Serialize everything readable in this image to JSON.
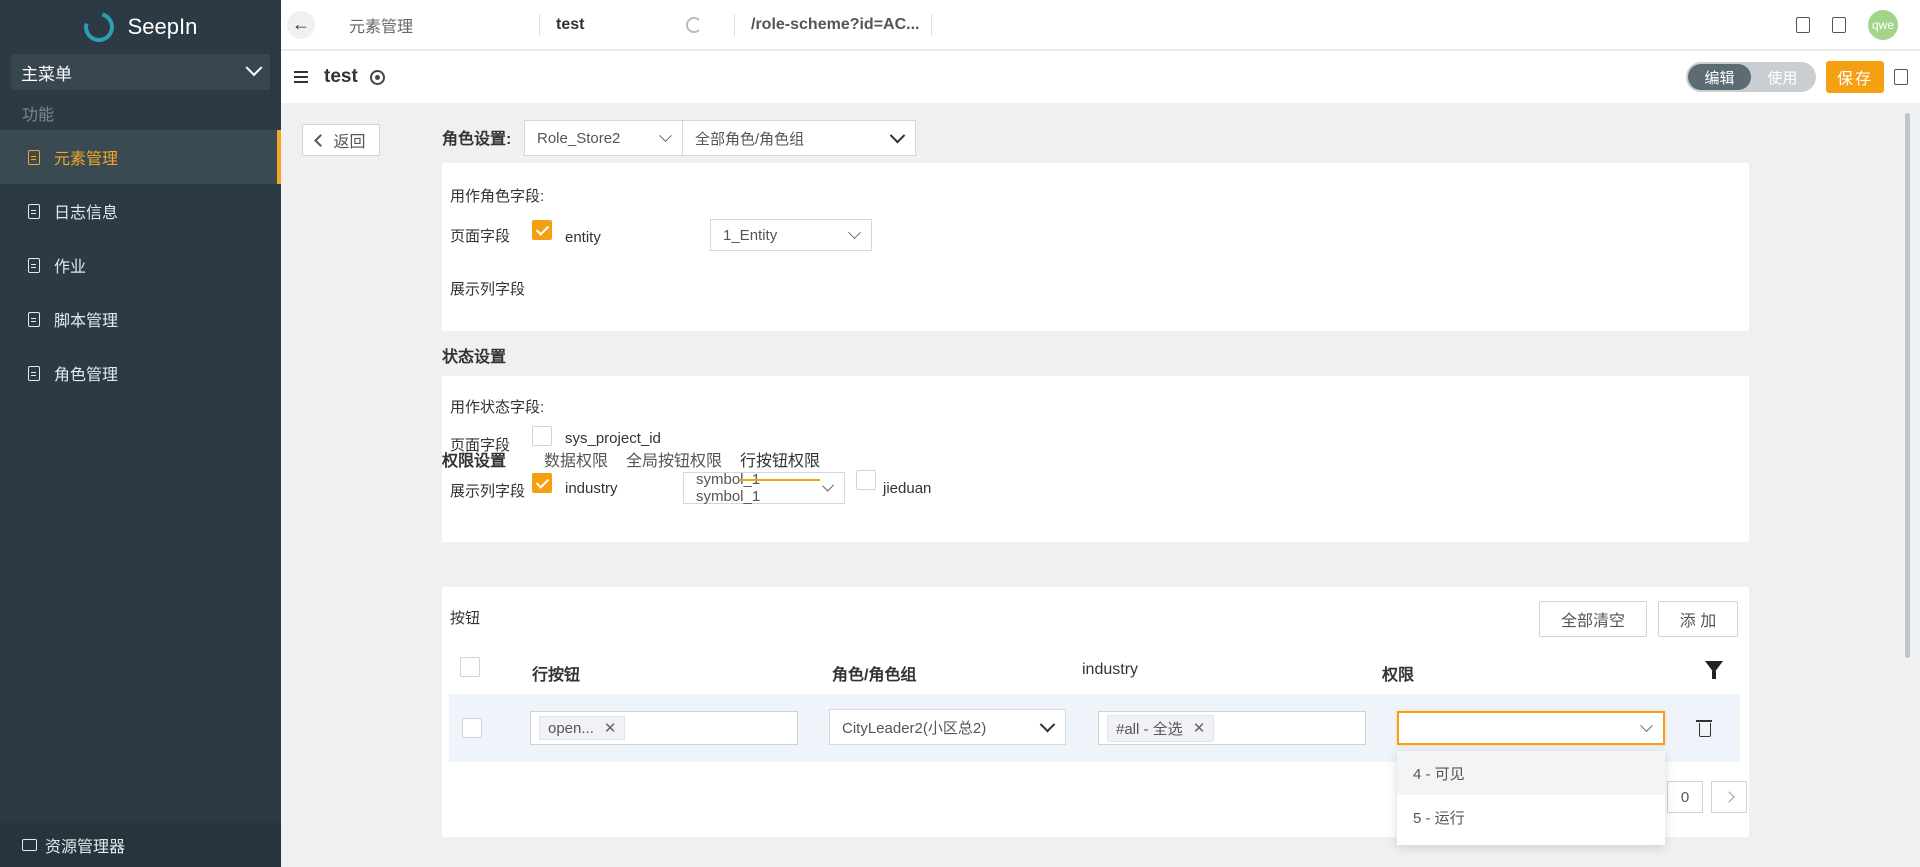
{
  "sidebar": {
    "brand": "SeepIn",
    "main_menu": "主菜单",
    "section": "功能",
    "items": [
      {
        "label": "元素管理",
        "active": true
      },
      {
        "label": "日志信息",
        "active": false
      },
      {
        "label": "作业",
        "active": false
      },
      {
        "label": "脚本管理",
        "active": false
      },
      {
        "label": "角色管理",
        "active": false
      }
    ],
    "resource_manager": "资源管理器"
  },
  "topbar": {
    "crumb": "元素管理",
    "page_tab": "test",
    "url": "/role-scheme?id=AC...",
    "avatar": "qwe"
  },
  "subheader": {
    "title": "test",
    "mode_edit": "编辑",
    "mode_use": "使用",
    "save": "保存"
  },
  "content": {
    "return": "返回",
    "role_settings_label": "角色设置:",
    "role_store": "Role_Store2",
    "role_group": "全部角色/角色组",
    "role_panel": {
      "heading": "用作角色字段:",
      "page_field_label": "页面字段",
      "entity_field": "entity",
      "entity_select": "1_Entity",
      "display_field_label": "展示列字段"
    },
    "state_settings_label": "状态设置",
    "state_panel": {
      "heading": "用作状态字段:",
      "page_field_label": "页面字段",
      "sys_field": "sys_project_id",
      "display_field_label": "展示列字段",
      "industry_field": "industry",
      "symbol_select": "symbol_1 - symbol_1",
      "jieduan_field": "jieduan"
    },
    "tabs": {
      "title": "权限设置",
      "items": [
        "数据权限",
        "全局按钮权限",
        "行按钮权限"
      ]
    },
    "buttons_panel": {
      "label": "按钮",
      "clear_all": "全部清空",
      "add": "添 加",
      "columns": [
        "行按钮",
        "角色/角色组",
        "industry",
        "权限"
      ],
      "row": {
        "button_tag": "open...",
        "role": "CityLeader2(小区总2)",
        "industry_tag": "#all - 全选",
        "permission": ""
      },
      "pager_page": "0"
    },
    "dropdown": {
      "options": [
        "4 - 可见",
        "5 - 运行"
      ]
    }
  }
}
